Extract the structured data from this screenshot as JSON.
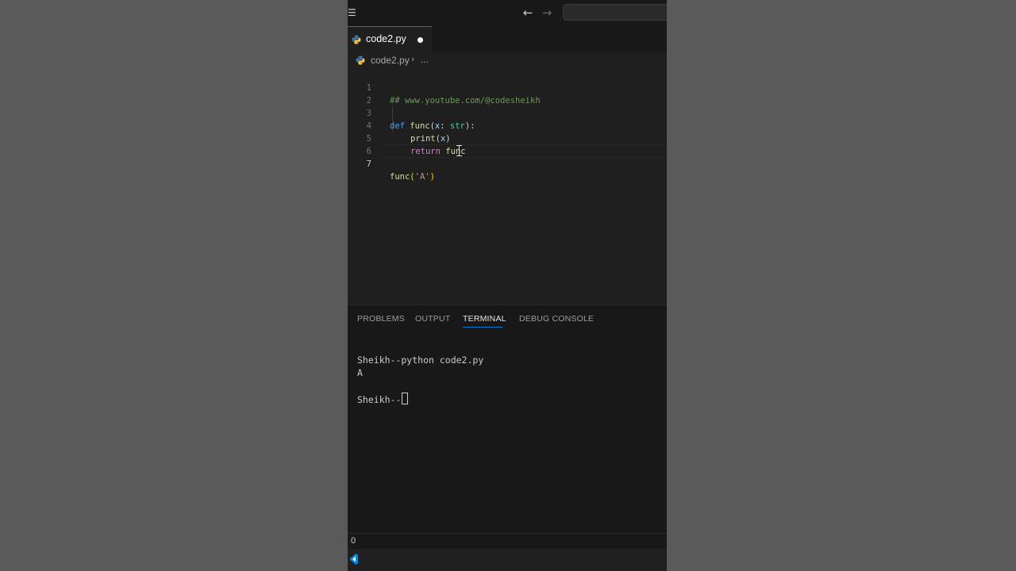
{
  "window": {
    "background": "#1f1f1f",
    "accent": "#0078d4"
  },
  "titlebar": {
    "menu_icon": "hamburger-menu-icon",
    "back_icon": "arrow-left-icon",
    "forward_icon": "arrow-right-icon"
  },
  "tab": {
    "label": "code2.py",
    "icon": "python-icon",
    "dirty": true
  },
  "breadcrumb": {
    "file": "code2.py",
    "separator": "›",
    "more": "..."
  },
  "editor": {
    "active_line": 7,
    "lines": [
      {
        "n": "1",
        "comment": "## www.youtube.com/@codesheikh"
      },
      {
        "n": "2"
      },
      {
        "n": "3",
        "kw": "def",
        "fn": "func",
        "p1": "(",
        "param": "x",
        "p2": ": ",
        "type": "str",
        "p3": "):"
      },
      {
        "n": "4",
        "fn": "print",
        "p1": "(",
        "param": "x",
        "p2": ")"
      },
      {
        "n": "5",
        "ctl": "return",
        "fn": " func"
      },
      {
        "n": "6"
      },
      {
        "n": "7",
        "fn": "func",
        "b1": "(",
        "str": "'A'",
        "b2": ")"
      }
    ]
  },
  "panel": {
    "tabs": [
      "PROBLEMS",
      "OUTPUT",
      "TERMINAL",
      "DEBUG CONSOLE"
    ],
    "active_tab": "TERMINAL",
    "terminal": {
      "command": "Sheikh--python code2.py",
      "output": "A",
      "prompt": "Sheikh--"
    }
  },
  "statusbar": {
    "problems_count": "0"
  },
  "taskbar": {
    "app_icon": "vscode-icon"
  }
}
